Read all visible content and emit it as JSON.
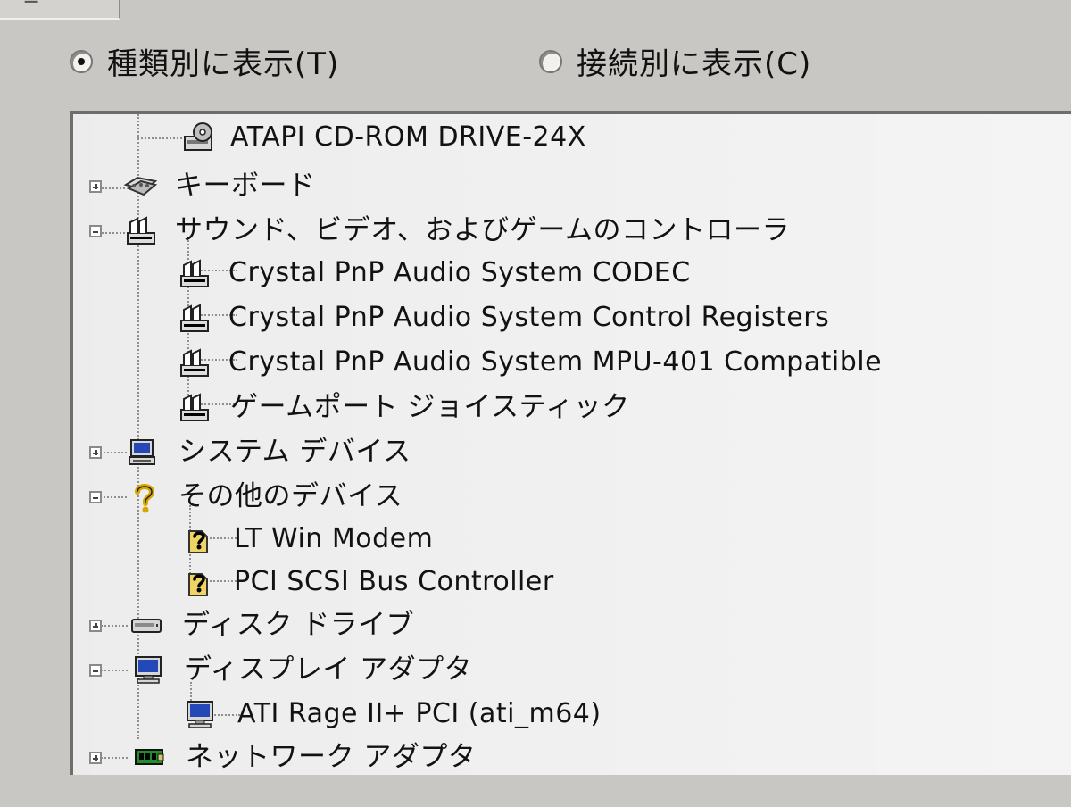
{
  "radio_options": {
    "by_type_label": "種類別に表示(T)",
    "by_connection_label": "接続別に表示(C)"
  },
  "tree": {
    "rows": [
      {
        "label": "ATAPI CD-ROM DRIVE-24X",
        "icon": "cdrom-drive-icon"
      },
      {
        "label": "キーボード",
        "icon": "keyboard-icon"
      },
      {
        "label": "サウンド、ビデオ、およびゲームのコントローラ",
        "icon": "sound-controller-icon"
      },
      {
        "label": "Crystal PnP Audio System CODEC",
        "icon": "sound-controller-icon"
      },
      {
        "label": "Crystal PnP Audio System Control Registers",
        "icon": "sound-controller-icon"
      },
      {
        "label": "Crystal PnP Audio System MPU-401 Compatible",
        "icon": "sound-controller-icon"
      },
      {
        "label": "ゲームポート ジョイスティック",
        "icon": "sound-controller-icon"
      },
      {
        "label": "システム デバイス",
        "icon": "system-devices-icon"
      },
      {
        "label": "その他のデバイス",
        "icon": "unknown-device-icon"
      },
      {
        "label": "LT Win Modem",
        "icon": "unknown-device-icon"
      },
      {
        "label": "PCI SCSI Bus Controller",
        "icon": "unknown-device-icon"
      },
      {
        "label": "ディスク ドライブ",
        "icon": "disk-drive-icon"
      },
      {
        "label": "ディスプレイ アダプタ",
        "icon": "display-adapter-icon"
      },
      {
        "label": "ATI Rage II+ PCI (ati_m64)",
        "icon": "display-adapter-icon"
      },
      {
        "label": "ネットワーク アダプタ",
        "icon": "network-adapter-icon"
      }
    ]
  }
}
